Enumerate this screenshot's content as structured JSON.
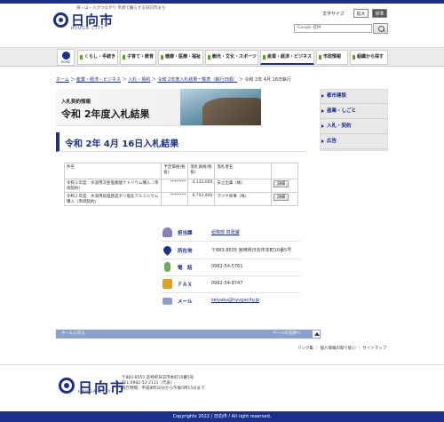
{
  "header": {
    "tagline": "海・山・人がつながり 笑顔で暮らせる日向市まち",
    "logo_text": "日向市",
    "logo_sub": "HYUGA CITY",
    "text_size_label": "文字サイズ",
    "size_large": "拡大",
    "size_standard": "標準",
    "search_placeholder": "Google 提供"
  },
  "nav": {
    "home": "HOME",
    "items": [
      "くらし・手続き",
      "子育て・教育",
      "健康・医療・福祉",
      "観光・文化・スポーツ",
      "産業・経済・ビジネス",
      "市政情報",
      "組織から探す"
    ]
  },
  "breadcrumb": {
    "items": [
      "ホーム",
      "産業・経済・ビジネス",
      "入札・契約",
      "令和 2年度入札結果一覧表（執行日順）"
    ],
    "current": "令和 2年 4月 16日執行"
  },
  "banner": {
    "small": "入札契約情報",
    "title": "令和 2年度入札結果"
  },
  "sidebar": {
    "items": [
      "都市建設",
      "産業・しごと",
      "入札・契約",
      "広告"
    ]
  },
  "page": {
    "title": "令和 2年 4月 16日入札結果"
  },
  "table": {
    "headers": [
      "件名",
      "予定価格(税抜)",
      "落札価格(税抜)",
      "落札者名",
      ""
    ],
    "rows": [
      {
        "name": "令和２年度　水道用次亜塩素酸ナトリウム購入（単価契約）",
        "planned": "********",
        "price": "4,332,000",
        "winner": "日之出薬（株）",
        "action": "詳細"
      },
      {
        "name": "令和２年度　水道用高塩基度ポリ塩化アルミニウム購入（単価契約）",
        "planned": "********",
        "price": "6,703,900",
        "winner": "マツヤ商事（株）",
        "action": "詳細"
      }
    ]
  },
  "contact": {
    "department_label": "担当課",
    "department": "総務部 財政課",
    "address_label": "所在地",
    "address": "〒883-8555 宮崎県日向市本町10番5号",
    "phone_label": "電　話",
    "phone": "0982-54-5761",
    "fax_label": "ＦＡＸ",
    "fax": "0982-54-8747",
    "mail_label": "メール",
    "mail": "keiyaku@hyugacity.jp"
  },
  "pagebar": {
    "top": "ホームに戻る",
    "next": "ページの先頭へ"
  },
  "footer": {
    "links": "リンク集 ｜ 個人情報の取り扱い ｜ サイトマップ",
    "logo_text": "日向市",
    "logo_sub": "HYUGA CITY",
    "address1": "〒883-8555 宮崎県日向市本町10番5号",
    "address2": "TEL:0982-52-2111（代表）",
    "address3": "開庁時間：平成8時30分から午後5時15分まで",
    "copyright": "Copyrights 2022 / 日向市 / All right reserved."
  }
}
